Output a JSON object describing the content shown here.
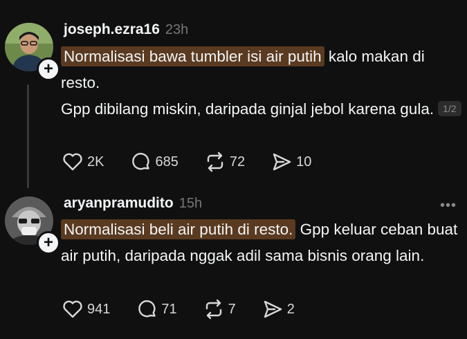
{
  "posts": [
    {
      "username": "joseph.ezra16",
      "time": "23h",
      "highlight": "Normalisasi bawa tumbler isi air putih",
      "text_rest": " kalo makan di resto.",
      "paragraph2": "Gpp dibilang miskin, daripada ginjal jebol karena gula.",
      "page_badge": "1/2",
      "likes": "2K",
      "replies": "685",
      "reposts": "72",
      "shares": "10"
    },
    {
      "username": "aryanpramudito",
      "time": "15h",
      "highlight": "Normalisasi beli air putih di resto.",
      "text_rest": " Gpp keluar ceban buat air putih, daripada nggak adil sama bisnis orang lain.",
      "likes": "941",
      "replies": "71",
      "reposts": "7",
      "shares": "2",
      "more_icon": "more-horizontal-icon"
    }
  ],
  "colors": {
    "background": "#101010",
    "highlight": "#5a3a20",
    "muted": "#777777"
  }
}
